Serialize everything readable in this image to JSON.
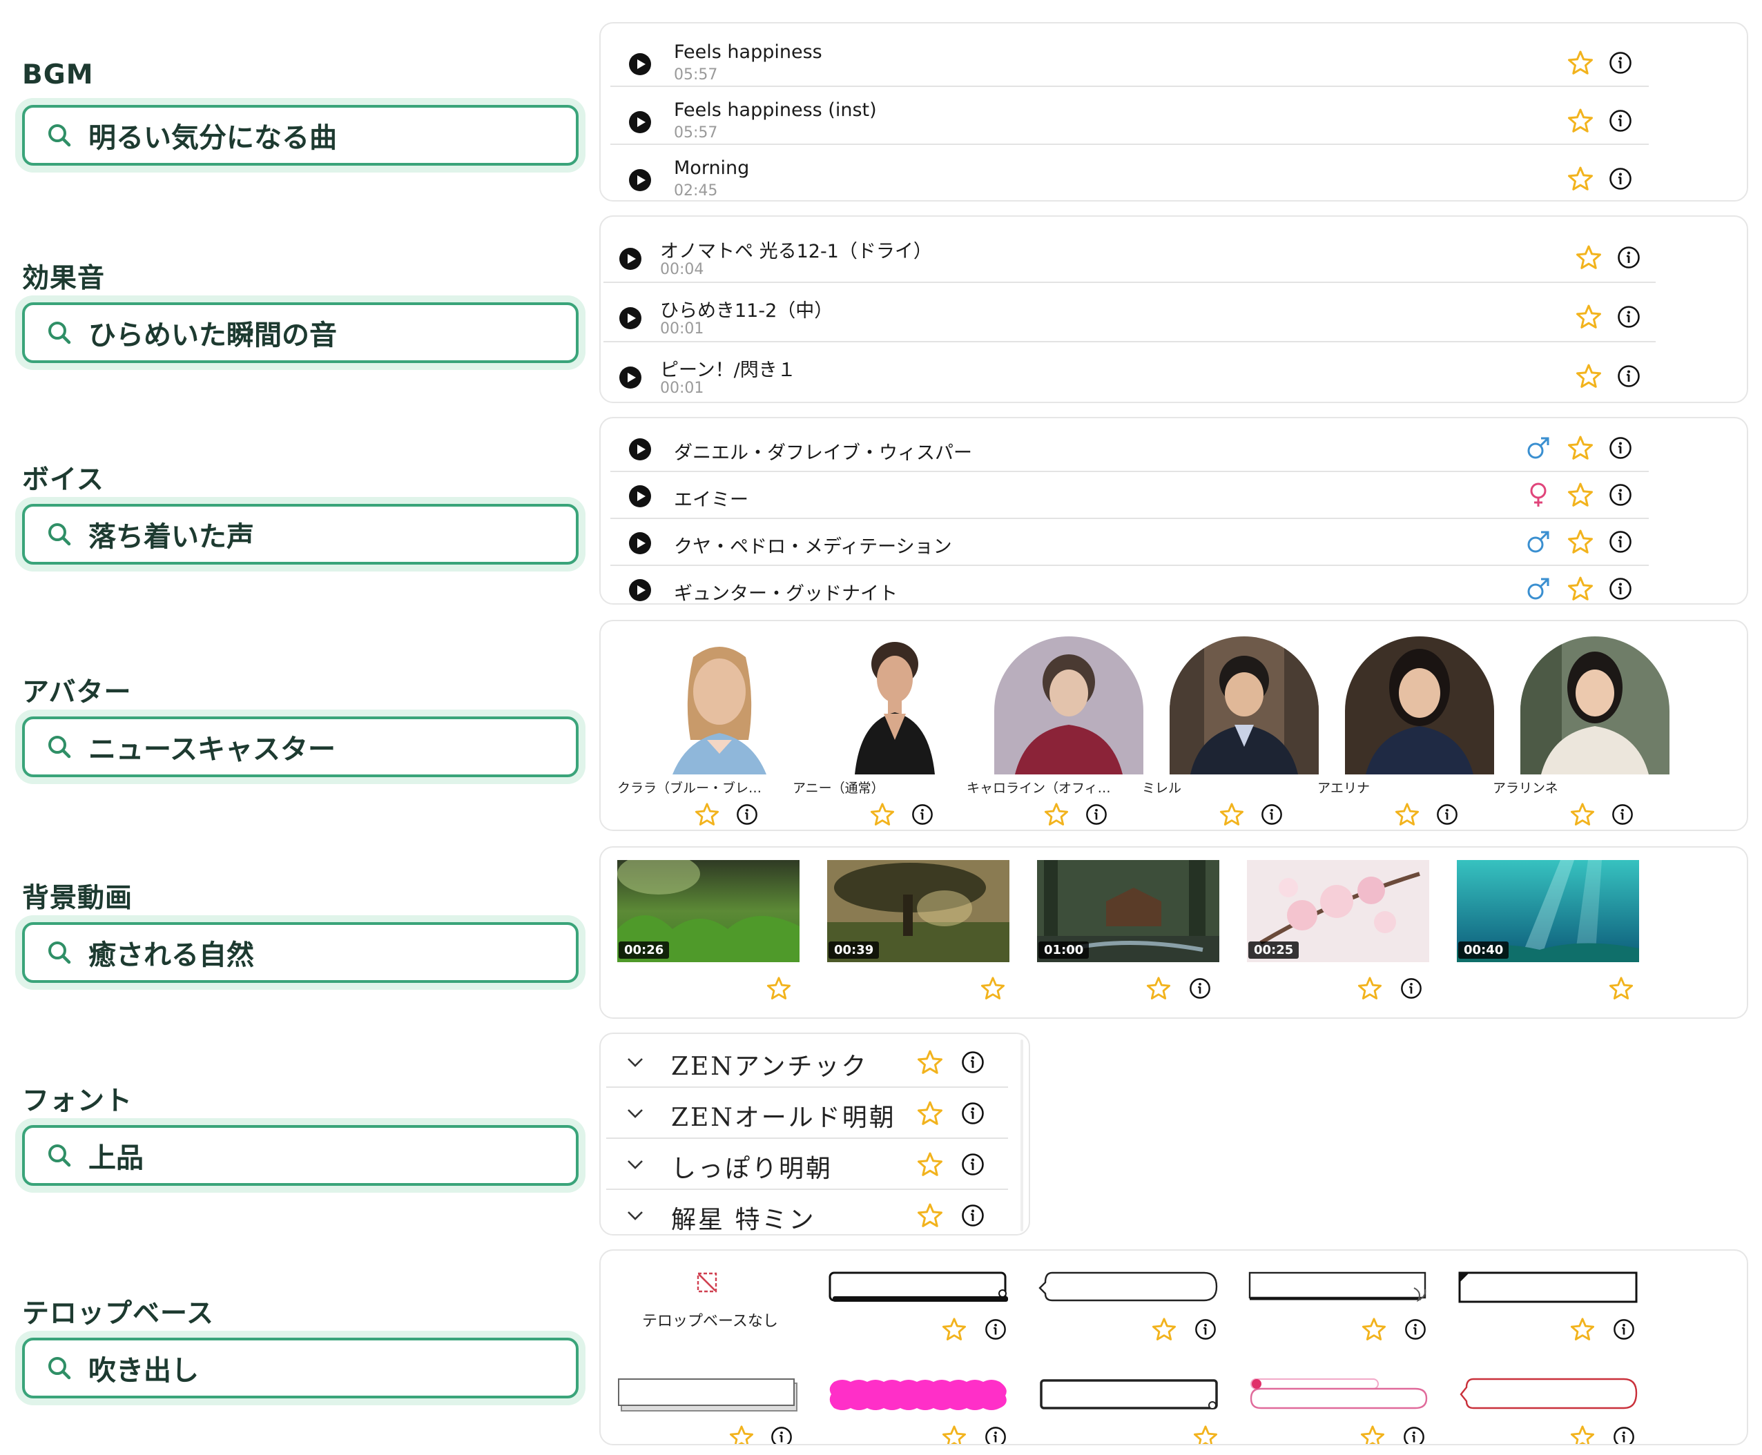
{
  "sections": {
    "bgm": {
      "label": "BGM",
      "query": "明るい気分になる曲"
    },
    "sfx": {
      "label": "効果音",
      "query": "ひらめいた瞬間の音"
    },
    "voice": {
      "label": "ボイス",
      "query": "落ち着いた声"
    },
    "avatar": {
      "label": "アバター",
      "query": "ニュースキャスター"
    },
    "video": {
      "label": "背景動画",
      "query": "癒される自然"
    },
    "font": {
      "label": "フォント",
      "query": "上品"
    },
    "telop": {
      "label": "テロップベース",
      "query": "吹き出し"
    }
  },
  "bgm_results": [
    {
      "title": "Feels happiness",
      "duration": "05:57"
    },
    {
      "title": "Feels happiness (inst)",
      "duration": "05:57"
    },
    {
      "title": "Morning",
      "duration": "02:45"
    }
  ],
  "sfx_results": [
    {
      "title": "オノマトペ 光る12-1（ドライ）",
      "duration": "00:04"
    },
    {
      "title": "ひらめき11-2（中）",
      "duration": "00:01"
    },
    {
      "title": "ピーン！/閃き１",
      "duration": "00:01"
    }
  ],
  "voice_results": [
    {
      "name": "ダニエル・ダフレイブ・ウィスパー",
      "gender": "male",
      "gender_icon": "male-icon"
    },
    {
      "name": "エイミー",
      "gender": "female",
      "gender_icon": "female-icon"
    },
    {
      "name": "クヤ・ペドロ・メディテーション",
      "gender": "male",
      "gender_icon": "male-icon"
    },
    {
      "name": "ギュンター・グッドナイト",
      "gender": "male",
      "gender_icon": "male-icon"
    }
  ],
  "avatar_results": [
    {
      "name": "クララ（ブルー・ブレ…"
    },
    {
      "name": "アニー（通常）"
    },
    {
      "name": "キャロライン（オフィ…"
    },
    {
      "name": "ミレル"
    },
    {
      "name": "アエリナ"
    },
    {
      "name": "アラリンネ"
    }
  ],
  "video_results": [
    {
      "duration": "00:26",
      "scene": "grass"
    },
    {
      "duration": "00:39",
      "scene": "tree"
    },
    {
      "duration": "01:00",
      "scene": "cabin"
    },
    {
      "duration": "00:25",
      "scene": "sakura"
    },
    {
      "duration": "00:40",
      "scene": "underwater"
    }
  ],
  "font_results": [
    {
      "name": "ZENアンチック"
    },
    {
      "name": "ZENオールド明朝"
    },
    {
      "name": "しっぽり明朝"
    },
    {
      "name": "解星 特ミン"
    }
  ],
  "telop_results": {
    "none_label": "テロップベースなし"
  },
  "colors": {
    "accent": "#3aa47a",
    "accent_soft": "#e0f4ea",
    "star": "#f2b31d",
    "male": "#3a8fd0",
    "female": "#e0447a",
    "telop_pink": "#ff2fc8",
    "telop_red": "#c9303a"
  }
}
